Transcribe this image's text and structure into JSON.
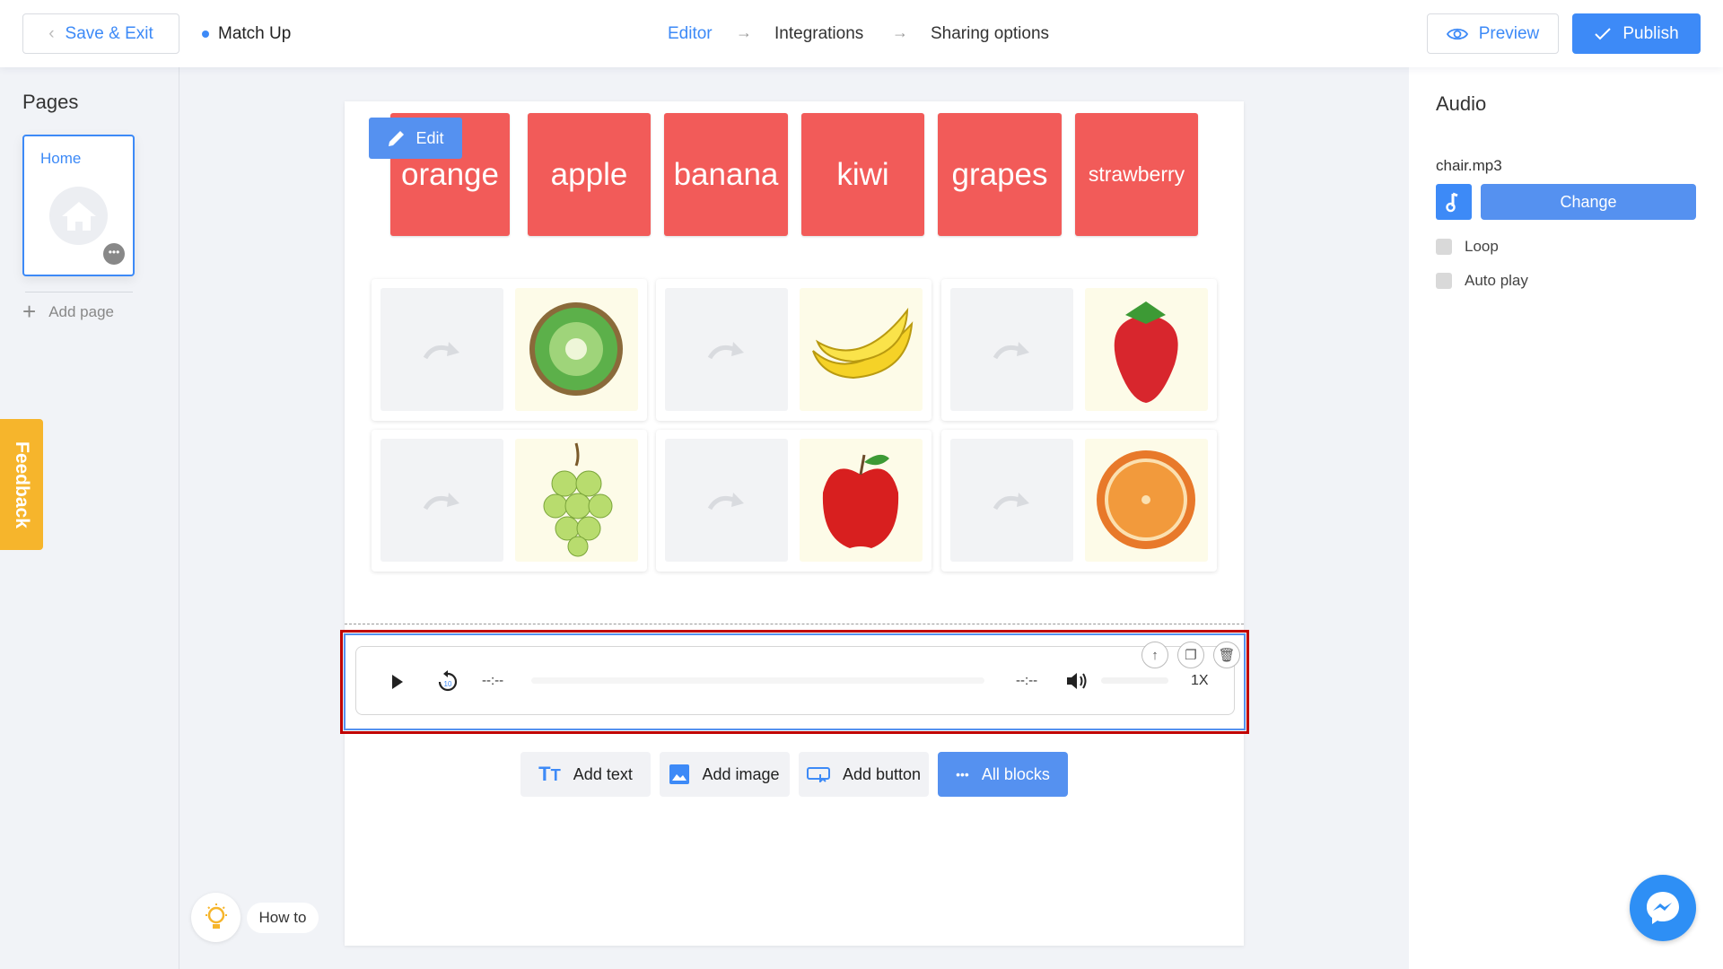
{
  "header": {
    "save_exit": "Save & Exit",
    "project_title": "Match Up",
    "steps": [
      "Editor",
      "Integrations",
      "Sharing options"
    ],
    "preview": "Preview",
    "publish": "Publish",
    "accent": "#3d8af7"
  },
  "sidebar": {
    "title": "Pages",
    "pages": [
      {
        "label": "Home"
      }
    ],
    "add_page": "Add page"
  },
  "feedback": "Feedback",
  "editor": {
    "edit_label": "Edit",
    "labels": [
      "orange",
      "apple",
      "banana",
      "kiwi",
      "grapes",
      "strawberry"
    ],
    "tile_color": "#f25b59",
    "pairs": [
      {
        "fruit": "kiwi"
      },
      {
        "fruit": "banana"
      },
      {
        "fruit": "strawberry"
      },
      {
        "fruit": "grapes"
      },
      {
        "fruit": "apple"
      },
      {
        "fruit": "orange"
      }
    ],
    "audio_player": {
      "time_current": "--:--",
      "time_total": "--:--",
      "speed": "1X",
      "replay_seconds": "10"
    },
    "add_blocks": {
      "add_text": "Add text",
      "add_image": "Add image",
      "add_button": "Add button",
      "all_blocks": "All blocks"
    }
  },
  "how_to": "How to",
  "panel": {
    "title": "Audio",
    "file_name": "chair.mp3",
    "change": "Change",
    "loop": "Loop",
    "auto_play": "Auto play"
  }
}
